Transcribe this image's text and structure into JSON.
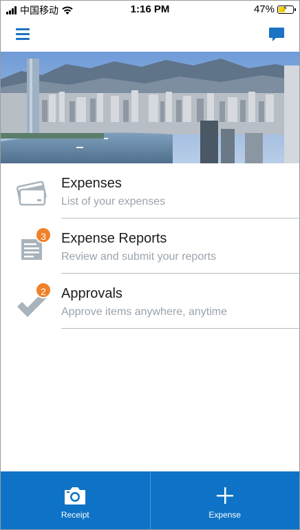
{
  "status_bar": {
    "carrier": "中国移动",
    "time": "1:16 PM",
    "battery_percent": "47%",
    "battery_level": 0.47
  },
  "nav": {
    "menu_icon": "hamburger-menu-icon",
    "chat_icon": "chat-bubble-icon"
  },
  "menu_items": [
    {
      "title": "Expenses",
      "subtitle": "List of your expenses",
      "icon": "credit-card-icon",
      "badge": ""
    },
    {
      "title": "Expense Reports",
      "subtitle": "Review and submit your reports",
      "icon": "report-document-icon",
      "badge": "3"
    },
    {
      "title": "Approvals",
      "subtitle": "Approve items anywhere, anytime",
      "icon": "checkmark-icon",
      "badge": "2"
    }
  ],
  "bottom_bar": {
    "receipt_label": "Receipt",
    "expense_label": "Expense"
  },
  "colors": {
    "accent": "#0e73c6",
    "badge": "#f0812a",
    "icon_gray": "#a9b3bc"
  }
}
